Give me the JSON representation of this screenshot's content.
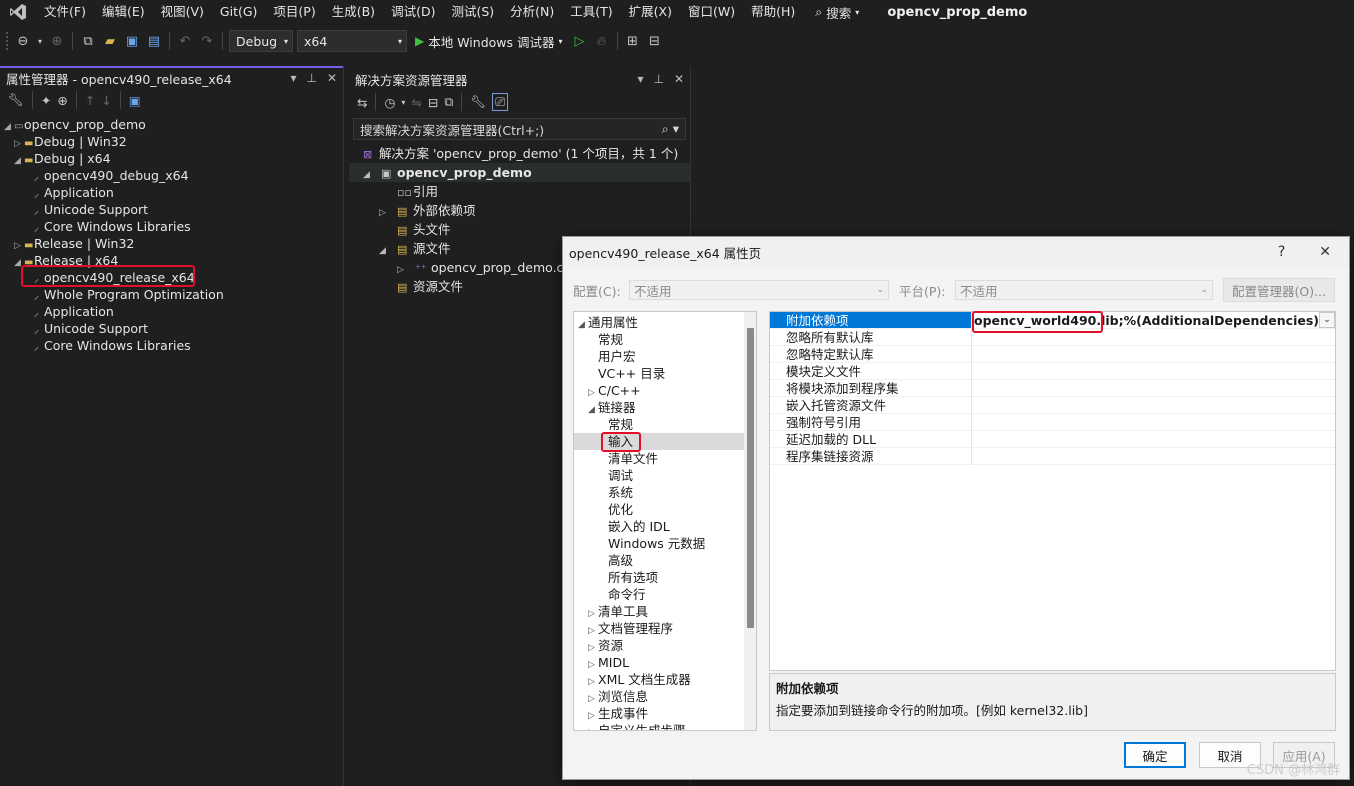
{
  "menubar": {
    "items": [
      "文件(F)",
      "编辑(E)",
      "视图(V)",
      "Git(G)",
      "项目(P)",
      "生成(B)",
      "调试(D)",
      "测试(S)",
      "分析(N)",
      "工具(T)",
      "扩展(X)",
      "窗口(W)",
      "帮助(H)"
    ],
    "search": "搜索",
    "title": "opencv_prop_demo"
  },
  "toolbar": {
    "config": "Debug",
    "platform": "x64",
    "run_label": "本地 Windows 调试器"
  },
  "property_manager": {
    "title": "属性管理器 - opencv490_release_x64",
    "tree": [
      {
        "label": "opencv_prop_demo",
        "level": 0,
        "arrow": "◢",
        "icon": "project"
      },
      {
        "label": "Debug | Win32",
        "level": 1,
        "arrow": "▷",
        "icon": "folder"
      },
      {
        "label": "Debug | x64",
        "level": 1,
        "arrow": "◢",
        "icon": "folder"
      },
      {
        "label": "opencv490_debug_x64",
        "level": 2,
        "icon": "wrench"
      },
      {
        "label": "Application",
        "level": 2,
        "icon": "wrench"
      },
      {
        "label": "Unicode Support",
        "level": 2,
        "icon": "wrench"
      },
      {
        "label": "Core Windows Libraries",
        "level": 2,
        "icon": "wrench"
      },
      {
        "label": "Release | Win32",
        "level": 1,
        "arrow": "▷",
        "icon": "folder"
      },
      {
        "label": "Release | x64",
        "level": 1,
        "arrow": "◢",
        "icon": "folder"
      },
      {
        "label": "opencv490_release_x64",
        "level": 2,
        "icon": "wrench",
        "selected": true
      },
      {
        "label": "Whole Program Optimization",
        "level": 2,
        "icon": "wrench"
      },
      {
        "label": "Application",
        "level": 2,
        "icon": "wrench"
      },
      {
        "label": "Unicode Support",
        "level": 2,
        "icon": "wrench"
      },
      {
        "label": "Core Windows Libraries",
        "level": 2,
        "icon": "wrench"
      }
    ]
  },
  "solution_explorer": {
    "title": "解决方案资源管理器",
    "search_placeholder": "搜索解决方案资源管理器(Ctrl+;)",
    "tree": [
      {
        "label": "解决方案 'opencv_prop_demo' (1 个项目，共 1 个)",
        "indent": 14,
        "icon": "solution"
      },
      {
        "label": "opencv_prop_demo",
        "indent": 14,
        "icon": "project",
        "arrow": "◢",
        "selected": true
      },
      {
        "label": "引用",
        "indent": 48,
        "icon": "ref"
      },
      {
        "label": "外部依赖项",
        "indent": 30,
        "icon": "folder",
        "arrow": "▷"
      },
      {
        "label": "头文件",
        "indent": 48,
        "icon": "folder"
      },
      {
        "label": "源文件",
        "indent": 30,
        "icon": "folder",
        "arrow": "◢"
      },
      {
        "label": "opencv_prop_demo.c",
        "indent": 48,
        "icon": "cpp",
        "arrow": "▷"
      },
      {
        "label": "资源文件",
        "indent": 48,
        "icon": "folder"
      }
    ]
  },
  "dialog": {
    "title": "opencv490_release_x64 属性页",
    "help": "?",
    "close": "✕",
    "config_label": "配置(C):",
    "config_value": "不适用",
    "platform_label": "平台(P):",
    "platform_value": "不适用",
    "config_manager": "配置管理器(O)...",
    "nav": [
      {
        "label": "通用属性",
        "level": 0,
        "arrow": "◢"
      },
      {
        "label": "常规",
        "level": 1
      },
      {
        "label": "用户宏",
        "level": 1
      },
      {
        "label": "VC++ 目录",
        "level": 1
      },
      {
        "label": "C/C++",
        "level": 1,
        "arrow": "▷"
      },
      {
        "label": "链接器",
        "level": 1,
        "arrow": "◢"
      },
      {
        "label": "常规",
        "level": 2
      },
      {
        "label": "输入",
        "level": 2,
        "selected": true
      },
      {
        "label": "清单文件",
        "level": 2
      },
      {
        "label": "调试",
        "level": 2
      },
      {
        "label": "系统",
        "level": 2
      },
      {
        "label": "优化",
        "level": 2
      },
      {
        "label": "嵌入的 IDL",
        "level": 2
      },
      {
        "label": "Windows 元数据",
        "level": 2
      },
      {
        "label": "高级",
        "level": 2
      },
      {
        "label": "所有选项",
        "level": 2
      },
      {
        "label": "命令行",
        "level": 2
      },
      {
        "label": "清单工具",
        "level": 1,
        "arrow": "▷"
      },
      {
        "label": "文档管理程序",
        "level": 1,
        "arrow": "▷"
      },
      {
        "label": "资源",
        "level": 1,
        "arrow": "▷"
      },
      {
        "label": "MIDL",
        "level": 1,
        "arrow": "▷"
      },
      {
        "label": "XML 文档生成器",
        "level": 1,
        "arrow": "▷"
      },
      {
        "label": "浏览信息",
        "level": 1,
        "arrow": "▷"
      },
      {
        "label": "生成事件",
        "level": 1,
        "arrow": "▷"
      },
      {
        "label": "自定义生成步骤",
        "level": 1,
        "arrow": "▷"
      }
    ],
    "props": [
      {
        "name": "附加依赖项",
        "value_highlight": "opencv_world490.lib;",
        "value_rest": "%(AdditionalDependencies)",
        "selected": true
      },
      {
        "name": "忽略所有默认库",
        "value_highlight": "",
        "value_rest": ""
      },
      {
        "name": "忽略特定默认库",
        "value_highlight": "",
        "value_rest": ""
      },
      {
        "name": "模块定义文件",
        "value_highlight": "",
        "value_rest": ""
      },
      {
        "name": "将模块添加到程序集",
        "value_highlight": "",
        "value_rest": ""
      },
      {
        "name": "嵌入托管资源文件",
        "value_highlight": "",
        "value_rest": ""
      },
      {
        "name": "强制符号引用",
        "value_highlight": "",
        "value_rest": ""
      },
      {
        "name": "延迟加载的 DLL",
        "value_highlight": "",
        "value_rest": ""
      },
      {
        "name": "程序集链接资源",
        "value_highlight": "",
        "value_rest": ""
      }
    ],
    "desc_title": "附加依赖项",
    "desc_text": "指定要添加到链接命令行的附加项。[例如 kernel32.lib]",
    "ok": "确定",
    "cancel": "取消",
    "apply": "应用(A)"
  },
  "watermark": "CSDN @林鸿群",
  "colors": {
    "accent": "#7160e8",
    "selection_blue": "#0078d7",
    "highlight_red": "#e0102a",
    "run_green": "#3fbf3f"
  }
}
